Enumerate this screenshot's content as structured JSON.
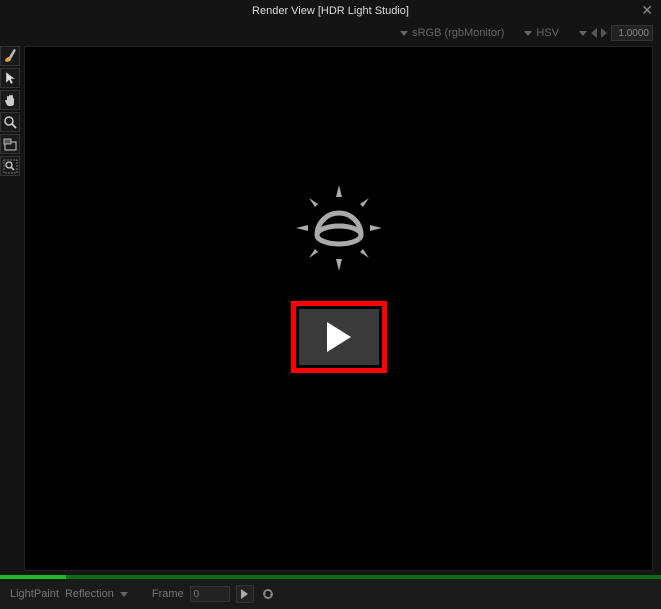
{
  "window": {
    "title": "Render View [HDR Light Studio]",
    "close_glyph": "✕"
  },
  "topbar": {
    "colorspace_label": "sRGB (rgbMonitor)",
    "model_label": "HSV",
    "exposure_value": "1.0000"
  },
  "status": {
    "tool_label": "LightPaint",
    "mode_label": "Reflection",
    "frame_label": "Frame",
    "frame_value": "0"
  },
  "tools": {
    "brush": "paint-brush-icon",
    "pointer": "pointer-icon",
    "hand": "hand-icon",
    "zoom": "magnifier-icon",
    "region": "render-region-icon",
    "zoomfit": "zoom-fit-icon"
  },
  "center": {
    "icon": "hdr-sun-icon",
    "play_label": "play"
  },
  "colors": {
    "highlight_border": "#ff0000",
    "progress_track": "#0a6b0a",
    "progress_fill": "#1dbb1d"
  }
}
